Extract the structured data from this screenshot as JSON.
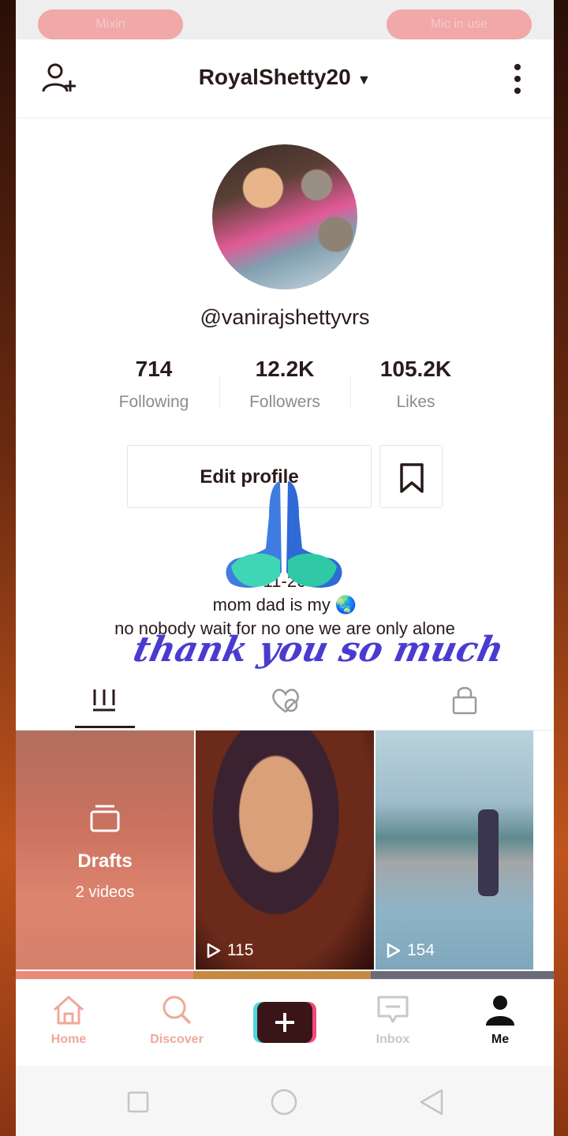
{
  "system_bar": {
    "left_pill": "Mixin",
    "right_pill": "Mic in use"
  },
  "header": {
    "username": "RoyalShetty20",
    "add_friend_icon": "person-plus-icon",
    "more_icon": "more-vertical-icon"
  },
  "profile": {
    "handle": "@vanirajshettyvrs",
    "stats": [
      {
        "value": "714",
        "label": "Following"
      },
      {
        "value": "12.2K",
        "label": "Followers"
      },
      {
        "value": "105.2K",
        "label": "Likes"
      }
    ],
    "edit_label": "Edit profile",
    "bio_line1": "11-20",
    "bio_line2": "mom dad is my 🌏",
    "bio_line3": "no nobody wait for no one we are only alone",
    "sticker_text": "thank you so much",
    "sticker_emoji": "folded-hands"
  },
  "tabs": [
    {
      "name": "videos",
      "icon": "grid-bars-icon"
    },
    {
      "name": "liked",
      "icon": "hidden-heart-icon"
    },
    {
      "name": "private",
      "icon": "lock-icon"
    }
  ],
  "videos": [
    {
      "type": "drafts",
      "title": "Drafts",
      "subtitle": "2 videos"
    },
    {
      "type": "video",
      "views": "115"
    },
    {
      "type": "video",
      "views": "154"
    }
  ],
  "bottom_nav": [
    {
      "label": "Home",
      "icon": "home-icon",
      "color": "#f0a89a"
    },
    {
      "label": "Discover",
      "icon": "search-icon",
      "color": "#f0a89a"
    },
    {
      "label": "",
      "icon": "plus-icon"
    },
    {
      "label": "Inbox",
      "icon": "message-icon",
      "color": "#c8c8c8"
    },
    {
      "label": "Me",
      "icon": "person-icon",
      "color": "#111111"
    }
  ],
  "colors": {
    "text_dark": "#2a1a1a",
    "muted": "#8b8b8b",
    "accent_pink": "#f0a89a",
    "sticker_blue": "#4a3bd0"
  }
}
